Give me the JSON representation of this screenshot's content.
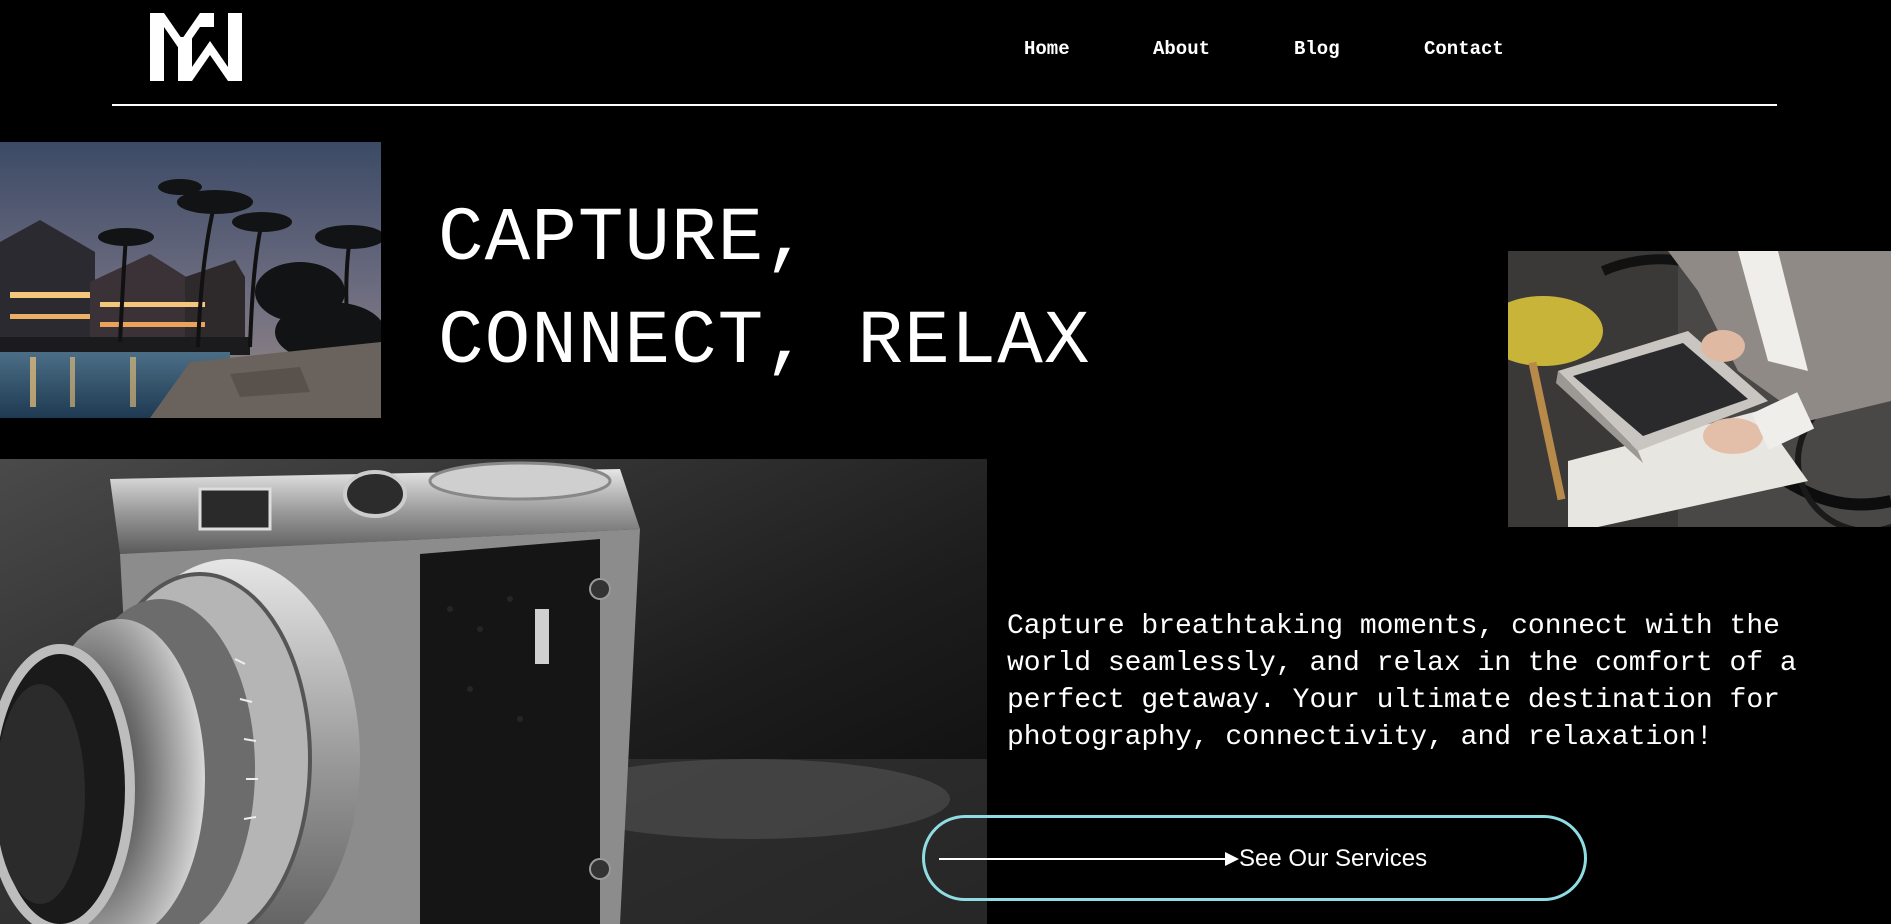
{
  "brand": {
    "logo_icon": "mw-monogram-logo-icon"
  },
  "nav": {
    "items": [
      {
        "label": "Home"
      },
      {
        "label": "About"
      },
      {
        "label": "Blog"
      },
      {
        "label": "Contact"
      }
    ]
  },
  "hero": {
    "title_line_1": "CAPTURE,",
    "title_line_2": "CONNECT, RELAX",
    "description": "Capture breathtaking moments, connect with the world seamlessly, and relax in the comfort of a perfect getaway. Your ultimate destination for photography, connectivity, and relaxation!",
    "cta_label": "See Our Services",
    "cta_icon": "arrow-right-icon"
  },
  "images": {
    "resort": "resort-pool-at-dusk-photo",
    "laptop": "person-typing-on-laptop-photo",
    "camera": "vintage-rangefinder-camera-bw-photo"
  },
  "colors": {
    "background": "#000000",
    "text": "#ffffff",
    "cta_border": "#8fdde3",
    "divider": "#ffffff"
  }
}
